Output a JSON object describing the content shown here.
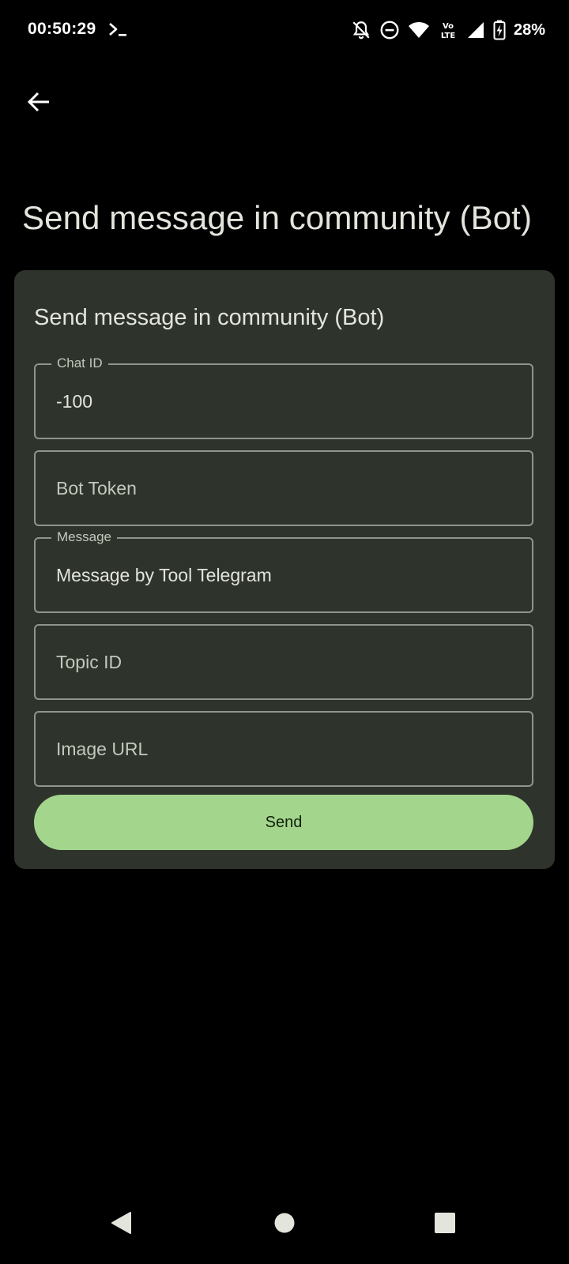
{
  "status_bar": {
    "time": "00:50:29",
    "battery": "28%",
    "icons": [
      "terminal-icon",
      "notifications-off-icon",
      "do-not-disturb-icon",
      "wifi-icon",
      "volte-icon",
      "signal-icon",
      "battery-charging-icon"
    ]
  },
  "app_bar": {
    "back_icon": "arrow-back-icon"
  },
  "page": {
    "title": "Send message in community (Bot)"
  },
  "card": {
    "title": "Send message in community (Bot)",
    "fields": [
      {
        "label": "Chat ID",
        "value": "-100",
        "placeholder": ""
      },
      {
        "label": "",
        "value": "",
        "placeholder": "Bot Token"
      },
      {
        "label": "Message",
        "value": "Message by Tool Telegram",
        "placeholder": ""
      },
      {
        "label": "",
        "value": "",
        "placeholder": "Topic ID"
      },
      {
        "label": "",
        "value": "",
        "placeholder": "Image URL"
      }
    ],
    "send_label": "Send"
  },
  "nav_bar": {
    "icons": [
      "back-triangle-icon",
      "home-circle-icon",
      "recents-square-icon"
    ]
  },
  "colors": {
    "background": "#000000",
    "card": "#2e342c",
    "outline": "#8f958b",
    "primary_button": "#a4d58d",
    "text": "#e3e4dc"
  }
}
